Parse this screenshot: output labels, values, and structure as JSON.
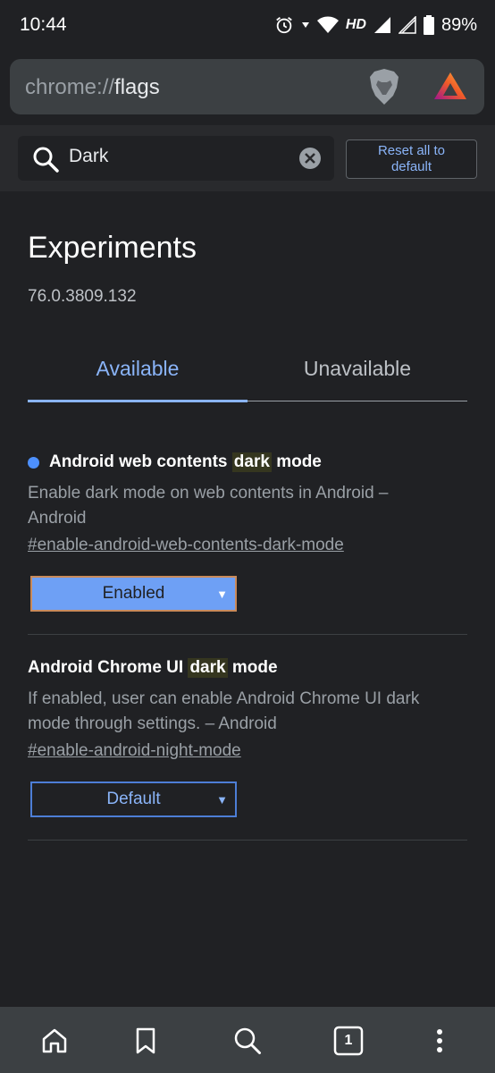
{
  "status_bar": {
    "time": "10:44",
    "network": "HD",
    "battery": "89%"
  },
  "url_bar": {
    "scheme": "chrome://",
    "path": "flags"
  },
  "search": {
    "value": "Dark",
    "reset_label_line1": "Reset all to",
    "reset_label_line2": "default"
  },
  "page": {
    "title": "Experiments",
    "version": "76.0.3809.132"
  },
  "tabs": [
    {
      "label": "Available",
      "active": true
    },
    {
      "label": "Unavailable",
      "active": false
    }
  ],
  "experiments": [
    {
      "title_before": "Android web contents ",
      "title_highlight": "dark",
      "title_after": " mode",
      "description_line1": "Enable dark mode on web contents in Android –",
      "description_line2": "Android",
      "link": "#enable-android-web-contents-dark-mode",
      "selected": "Enabled",
      "modified": true
    },
    {
      "title_before": "Android Chrome UI ",
      "title_highlight": "dark",
      "title_after": " mode",
      "description_line1": "If enabled, user can enable Android Chrome UI dark",
      "description_line2": "mode through settings. – Android",
      "link": "#enable-android-night-mode",
      "selected": "Default",
      "modified": false
    }
  ],
  "bottom_bar": {
    "tab_count": "1",
    "icons": [
      "home-icon",
      "bookmark-icon",
      "search-icon",
      "tab-switcher-icon",
      "more-vert-icon"
    ]
  },
  "colors": {
    "accent": "#8ab4f8",
    "background": "#202124",
    "modified_dot": "#4d90fe",
    "enabled_select": "#6ea0f5"
  }
}
